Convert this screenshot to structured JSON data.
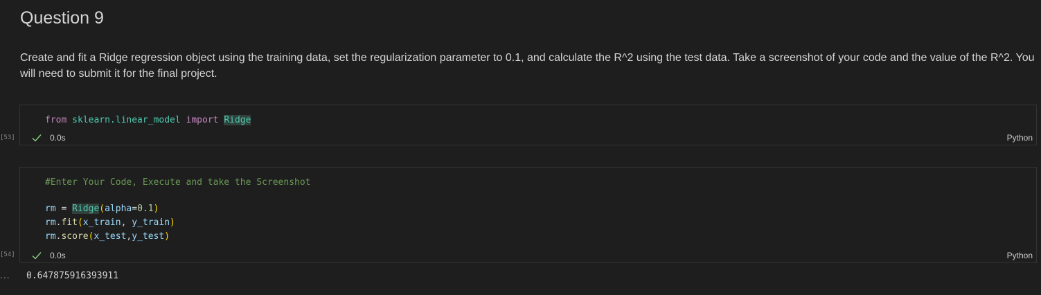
{
  "markdown": {
    "heading": "Question 9",
    "paragraph": "Create and fit a Ridge regression object using the training data, set the regularization parameter to 0.1, and calculate the R^2 using the test data. Take a screenshot of your code and the value of the R^2. You will need to submit it for the final project."
  },
  "cells": [
    {
      "execution_count": "[53]",
      "code_lines": [
        "from sklearn.linear_model import Ridge"
      ],
      "status": "success",
      "duration": "0.0s",
      "language": "Python"
    },
    {
      "execution_count": "[54]",
      "code_lines": [
        "#Enter Your Code, Execute and take the Screenshot",
        "",
        "rm = Ridge(alpha=0.1)",
        "rm.fit(x_train, y_train)",
        "rm.score(x_test,y_test)"
      ],
      "status": "success",
      "duration": "0.0s",
      "language": "Python",
      "output_menu": "...",
      "output": "0.647875916393911"
    }
  ],
  "colors": {
    "background": "#1e1e1e",
    "success_check": "#89d185",
    "keyword": "#c586c0",
    "class": "#4ec9b0",
    "variable": "#9cdcfe",
    "function": "#dcdcaa",
    "number": "#b5cea8",
    "comment": "#6a9955",
    "paren": "#ffd700"
  },
  "icons": {
    "status_success": "check-icon",
    "output_menu": "ellipsis-icon"
  }
}
